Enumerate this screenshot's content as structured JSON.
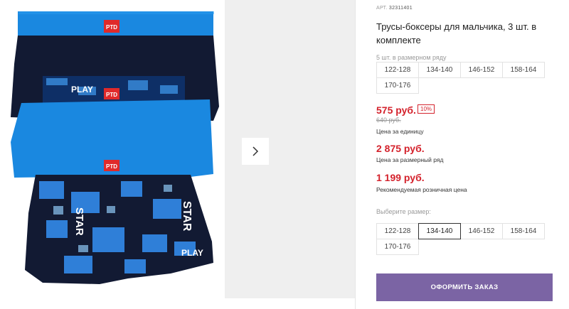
{
  "product": {
    "article_label": "АРТ.",
    "article": "32311401",
    "title": "Трусы-боксеры для мальчика, 3 шт. в комплекте",
    "brand_tag": "PTD",
    "print_words": [
      "PLAY",
      "STAR"
    ]
  },
  "size_row": {
    "label": "5 шт. в размерном ряду",
    "sizes": [
      "122-128",
      "134-140",
      "146-152",
      "158-164",
      "170-176"
    ]
  },
  "pricing": {
    "unit_price": "575 руб.",
    "discount": "10%",
    "old_price": "640 руб.",
    "unit_caption": "Цена за единицу",
    "row_price": "2 875 руб.",
    "row_caption": "Цена за размерный ряд",
    "retail_price": "1 199 руб.",
    "retail_caption": "Рекомендуемая розничная цена"
  },
  "size_select": {
    "label": "Выберите размер:",
    "sizes": [
      "122-128",
      "134-140",
      "146-152",
      "158-164",
      "170-176"
    ],
    "selected": "134-140"
  },
  "order_button": "ОФОРМИТЬ ЗАКАЗ",
  "colors": {
    "accent_red": "#d4222c",
    "button_purple": "#7b64a4",
    "navy": "#121a33",
    "blue": "#1a88e0"
  }
}
